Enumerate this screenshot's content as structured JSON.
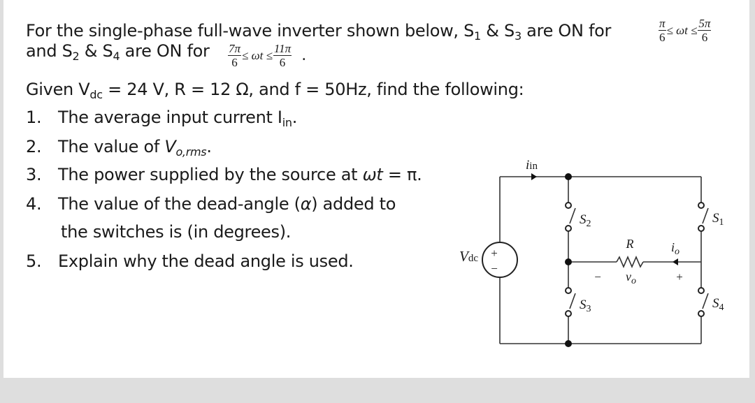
{
  "problem": {
    "line1_prefix": "For the single-phase full-wave inverter shown below, S",
    "line1_s1_sub": "1",
    "line1_amp": " & S",
    "line1_s3_sub": "3",
    "line1_suffix": " are ON for ",
    "s13_interval": {
      "lower_num": "π",
      "lower_den": "6",
      "rel": "≤ ωt ≤",
      "upper_num": "5π",
      "upper_den": "6"
    },
    "line2_prefix": "and S",
    "line2_s2_sub": "2",
    "line2_amp": " & S",
    "line2_s4_sub": "4",
    "line2_suffix": " are ON for ",
    "s24_interval": {
      "lower_num": "7π",
      "lower_den": "6",
      "rel": "≤ ωt ≤",
      "upper_num": "11π",
      "upper_den": "6"
    },
    "line2_end": ".",
    "given_prefix": "Given V",
    "given_vdc_sub": "dc",
    "given_suffix": " = 24 V, R = 12 Ω, and  f = 50Hz, find the following:",
    "questions": [
      {
        "num": "1.",
        "text": "The average input current I",
        "sub": "in",
        "end": "."
      },
      {
        "num": "2.",
        "text": "The value of ",
        "var": "V",
        "sub": "o,rms",
        "end": "."
      },
      {
        "num": "3.",
        "text": "The power supplied by the source at ",
        "var": "ωt",
        "end": " = π."
      },
      {
        "num": "4.",
        "text": "The value of the dead-angle (",
        "var": "α",
        "end": ") added to",
        "cont": "the switches is (in degrees)."
      },
      {
        "num": "5.",
        "text": "Explain why the dead angle is used."
      }
    ]
  },
  "circuit": {
    "source_label": "V",
    "source_label_sub": "dc",
    "source_plus": "+",
    "source_minus": "−",
    "input_current_label": "i",
    "input_current_sub": "in",
    "switches": {
      "s1": "S",
      "s1_sub": "1",
      "s2": "S",
      "s2_sub": "2",
      "s3": "S",
      "s3_sub": "3",
      "s4": "S",
      "s4_sub": "4"
    },
    "resistor_label": "R",
    "output_current_label": "i",
    "output_current_sub": "o",
    "output_voltage_label": "v",
    "output_voltage_sub": "o",
    "vo_minus": "−",
    "vo_plus": "+"
  }
}
